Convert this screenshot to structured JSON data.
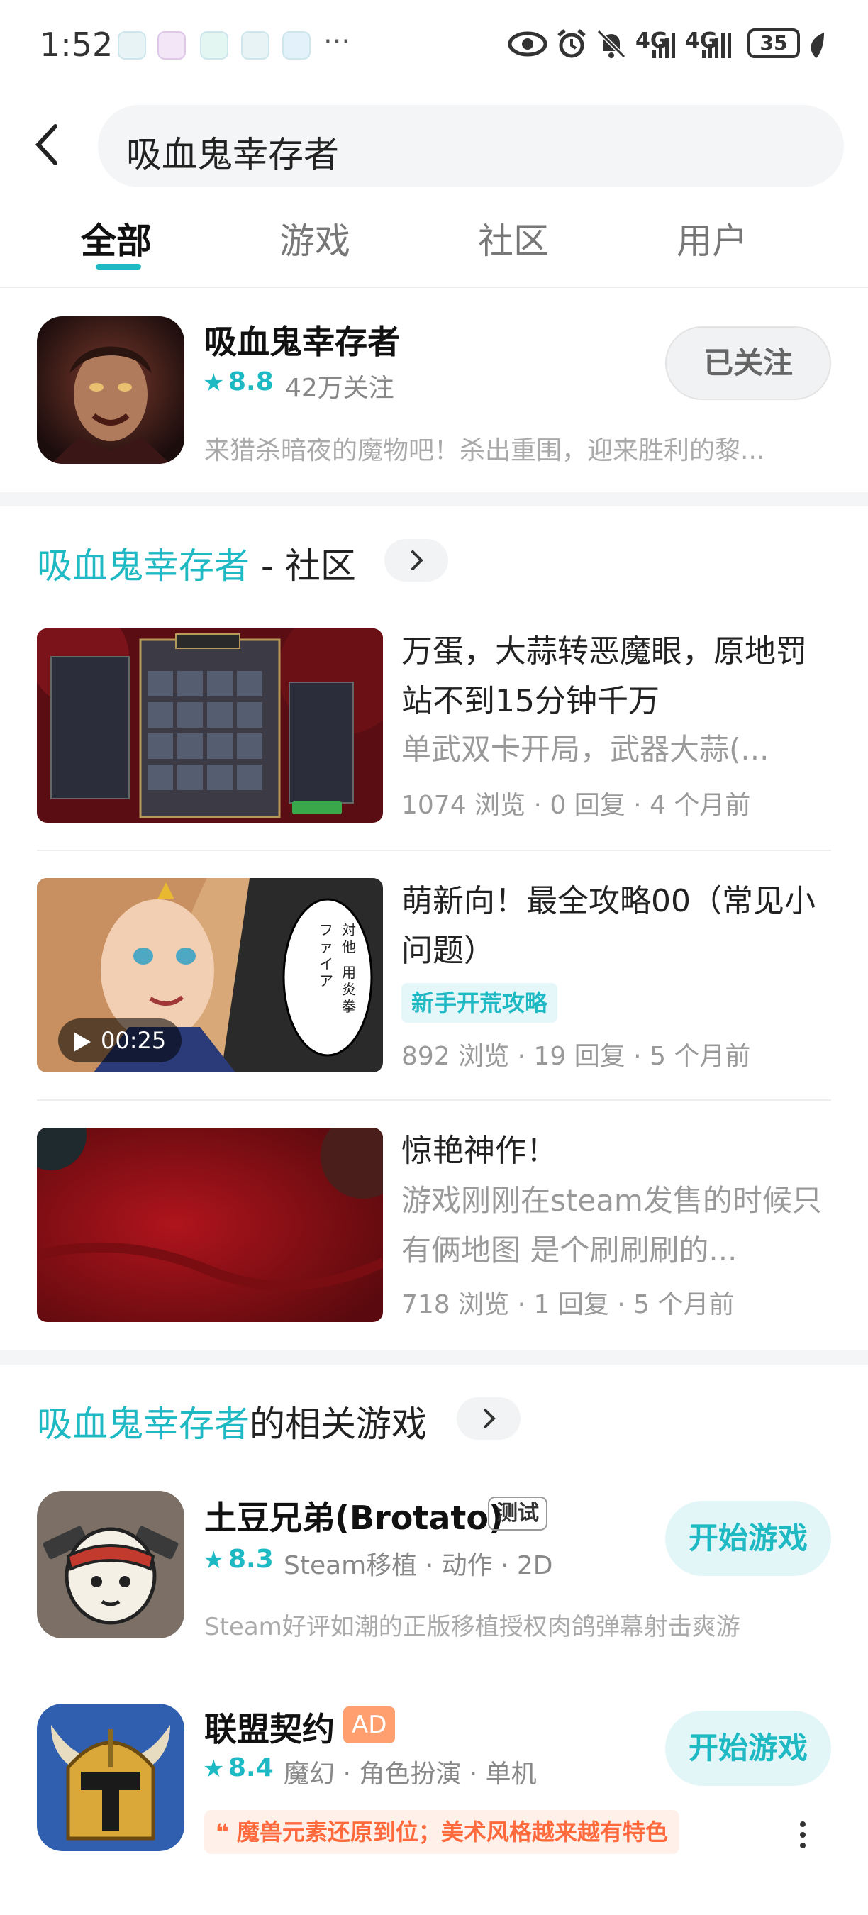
{
  "status_bar": {
    "time": "1:52",
    "more": "···",
    "net1": "4G",
    "net2": "4G",
    "battery": "35"
  },
  "search": {
    "query": "吸血鬼幸存者"
  },
  "tabs": [
    {
      "label": "全部"
    },
    {
      "label": "游戏"
    },
    {
      "label": "社区"
    },
    {
      "label": "用户"
    }
  ],
  "top_game": {
    "name": "吸血鬼幸存者",
    "rating": "8.8",
    "followers": "42万关注",
    "description": "来猎杀暗夜的魔物吧！杀出重围，迎来胜利的黎...",
    "follow_label": "已关注"
  },
  "community": {
    "title_highlight": "吸血鬼幸存者",
    "title_suffix": " - 社区",
    "posts": [
      {
        "title": "万蛋，大蒜转恶魔眼，原地罚站不到15分钟千万",
        "subtitle": "单武双卡开局，武器大蒜(...",
        "stats": "1074 浏览 · 0 回复 · 4 个月前"
      },
      {
        "title": "萌新向！最全攻略00（常见小问题）",
        "tag": "新手开荒攻略",
        "video_duration": "00:25",
        "stats": "892 浏览 · 19 回复 · 5 个月前"
      },
      {
        "title": "惊艳神作！",
        "subtitle": "游戏刚刚在steam发售的时候只有俩地图 是个刷刷刷的...",
        "stats": "718 浏览 · 1 回复 · 5 个月前"
      }
    ]
  },
  "related": {
    "title_highlight": "吸血鬼幸存者",
    "title_suffix": "的相关游戏",
    "games": [
      {
        "name": "土豆兄弟(Brotato)",
        "badge": "测试",
        "rating": "8.3",
        "meta": "Steam移植 · 动作 · 2D",
        "description": "Steam好评如潮的正版移植授权肉鸽弹幕射击爽游",
        "button": "开始游戏"
      },
      {
        "name": "联盟契约",
        "badge": "AD",
        "rating": "8.4",
        "meta": "魔幻 · 角色扮演 · 单机",
        "quote": "魔兽元素还原到位；美术风格越来越有特色",
        "button": "开始游戏"
      }
    ]
  },
  "icons": {
    "star": "★",
    "quote_mark": "❝"
  },
  "colors": {
    "accent": "#1fb9c4",
    "ad": "#ff9e6e",
    "quote": "#ff6a3d"
  }
}
